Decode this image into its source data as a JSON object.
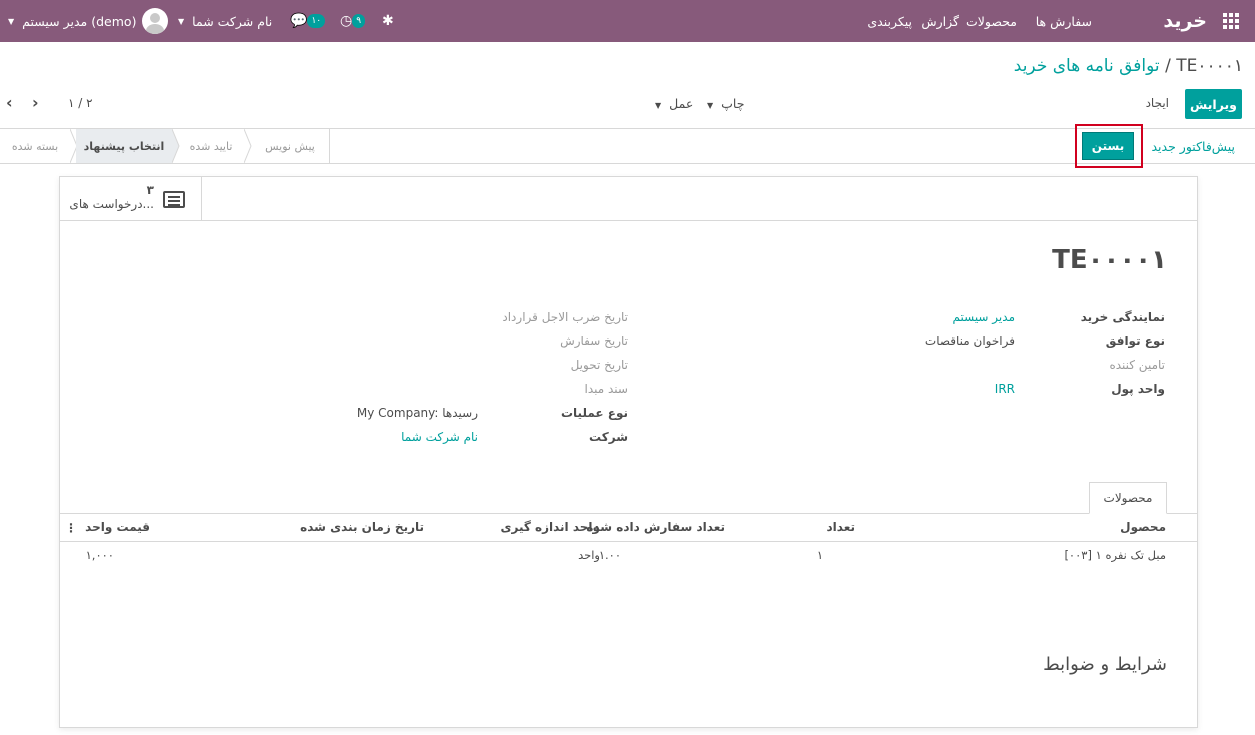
{
  "navbar": {
    "brand": "خرید",
    "menu": [
      "سفارش ها",
      "محصولات",
      "گزارش",
      "پیکربندی"
    ],
    "user_name": "مدیر سیستم (demo)",
    "company_name": "نام شرکت شما",
    "chat_count": "۱۰",
    "activity_count": "۹",
    "bg_color": "#875a7b"
  },
  "breadcrumb": {
    "parent": "توافق نامه های خرید",
    "separator": "/",
    "current": "TE۰۰۰۰۱"
  },
  "control_panel": {
    "edit_label": "ویرایش",
    "create_label": "ایجاد",
    "print_label": "چاپ",
    "action_label": "عمل",
    "pager": "۱ / ۲"
  },
  "statusbar": {
    "new_quotation_label": "پیش‌فاکتور جدید",
    "close_label": "بستن",
    "stages": [
      {
        "label": "بسته شده",
        "active": false
      },
      {
        "label": "انتخاب پیشنهاد",
        "active": true
      },
      {
        "label": "تایید شده",
        "active": false
      },
      {
        "label": "پیش نویس",
        "active": false
      }
    ]
  },
  "smart_button": {
    "count": "۳",
    "label": "درخواست های..."
  },
  "record": {
    "name": "TE۰۰۰۰۱",
    "fields_right": [
      {
        "label": "نمایندگی خرید",
        "value": "مدیر سیستم",
        "bold": true,
        "link": true
      },
      {
        "label": "نوع توافق",
        "value": "فراخوان مناقصات",
        "bold": true,
        "link": false
      },
      {
        "label": "تامین کننده",
        "value": "",
        "bold": false,
        "link": false
      },
      {
        "label": "واحد پول",
        "value": "IRR",
        "bold": true,
        "link": true
      }
    ],
    "fields_left": [
      {
        "label": "تاریخ ضرب الاجل قرارداد",
        "value": "",
        "bold": false,
        "link": false
      },
      {
        "label": "تاریخ سفارش",
        "value": "",
        "bold": false,
        "link": false
      },
      {
        "label": "تاریخ تحویل",
        "value": "",
        "bold": false,
        "link": false
      },
      {
        "label": "سند مبدا",
        "value": "",
        "bold": false,
        "link": false
      },
      {
        "label": "نوع عملیات",
        "value": "My Company: رسیدها",
        "bold": true,
        "link": false
      },
      {
        "label": "شرکت",
        "value": "نام شرکت شما",
        "bold": true,
        "link": true
      }
    ]
  },
  "tabs": {
    "products_label": "محصولات"
  },
  "lines_table": {
    "headers": {
      "product": "محصول",
      "quantity": "تعداد",
      "ordered_qty": "تعداد سفارش داده شده",
      "uom": "واحد اندازه گیری",
      "scheduled_date": "تاریخ زمان بندی شده",
      "unit_price": "قیمت واحد"
    },
    "rows": [
      {
        "product": "[۰۰۳] مبل تک نفره ۱",
        "quantity": "۱",
        "ordered_qty": "۱.۰۰",
        "uom": "واحد",
        "scheduled_date": "",
        "unit_price": "۱,۰۰۰"
      }
    ]
  },
  "terms": {
    "title": "شرایط و ضوابط"
  },
  "colors": {
    "primary": "#00a09d",
    "highlight": "#d1001f"
  }
}
